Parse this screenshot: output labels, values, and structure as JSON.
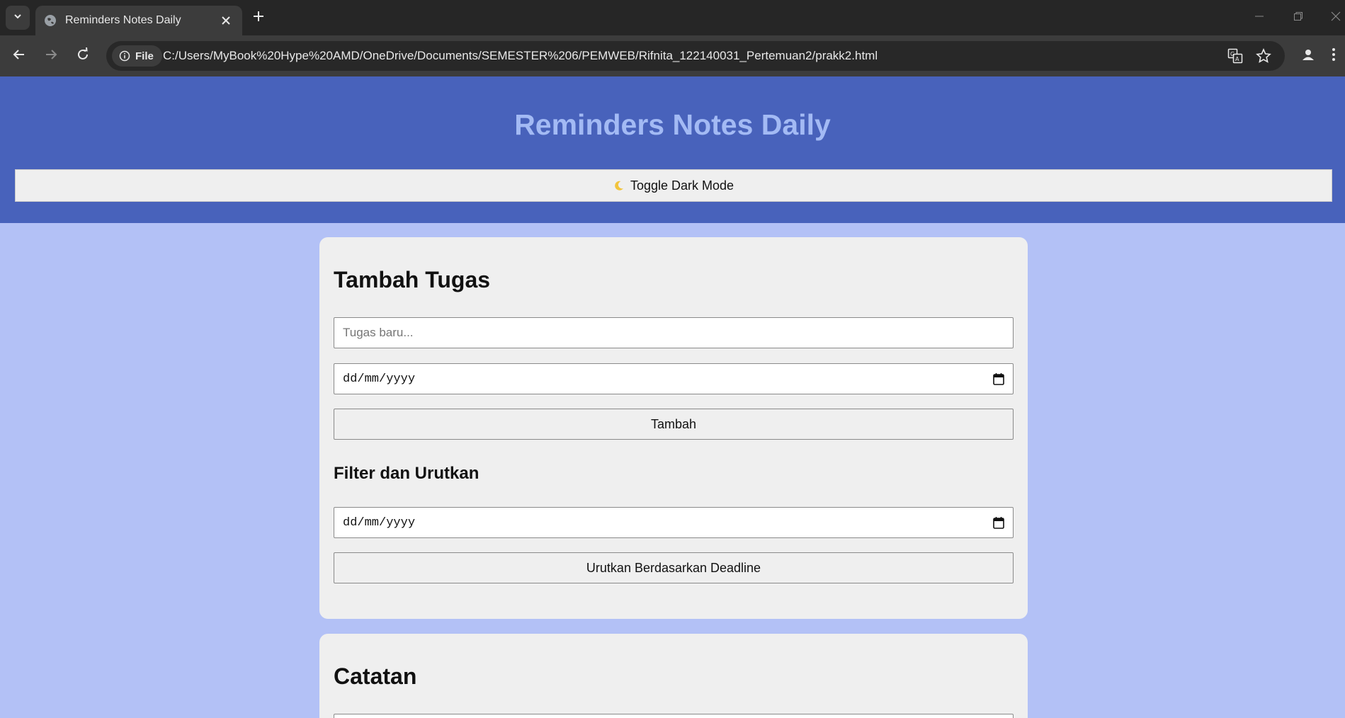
{
  "browser": {
    "tab_title": "Reminders Notes Daily",
    "site_chip_label": "File",
    "url": "C:/Users/MyBook%20Hype%20AMD/OneDrive/Documents/SEMESTER%206/PEMWEB/Rifnita_122140031_Pertemuan2/prakk2.html"
  },
  "header": {
    "title": "Reminders Notes Daily",
    "toggle_label": "Toggle Dark Mode"
  },
  "add_task": {
    "heading": "Tambah Tugas",
    "task_placeholder": "Tugas baru...",
    "date_placeholder": "dd/mm/yyyy",
    "add_button": "Tambah"
  },
  "filter": {
    "heading": "Filter dan Urutkan",
    "date_placeholder": "dd/mm/yyyy",
    "sort_button": "Urutkan Berdasarkan Deadline"
  },
  "notes": {
    "heading": "Catatan"
  },
  "colors": {
    "header_bg": "#4862bb",
    "title_color": "#a3baf4",
    "page_bg": "#b3c1f6",
    "card_bg": "#efefef"
  }
}
